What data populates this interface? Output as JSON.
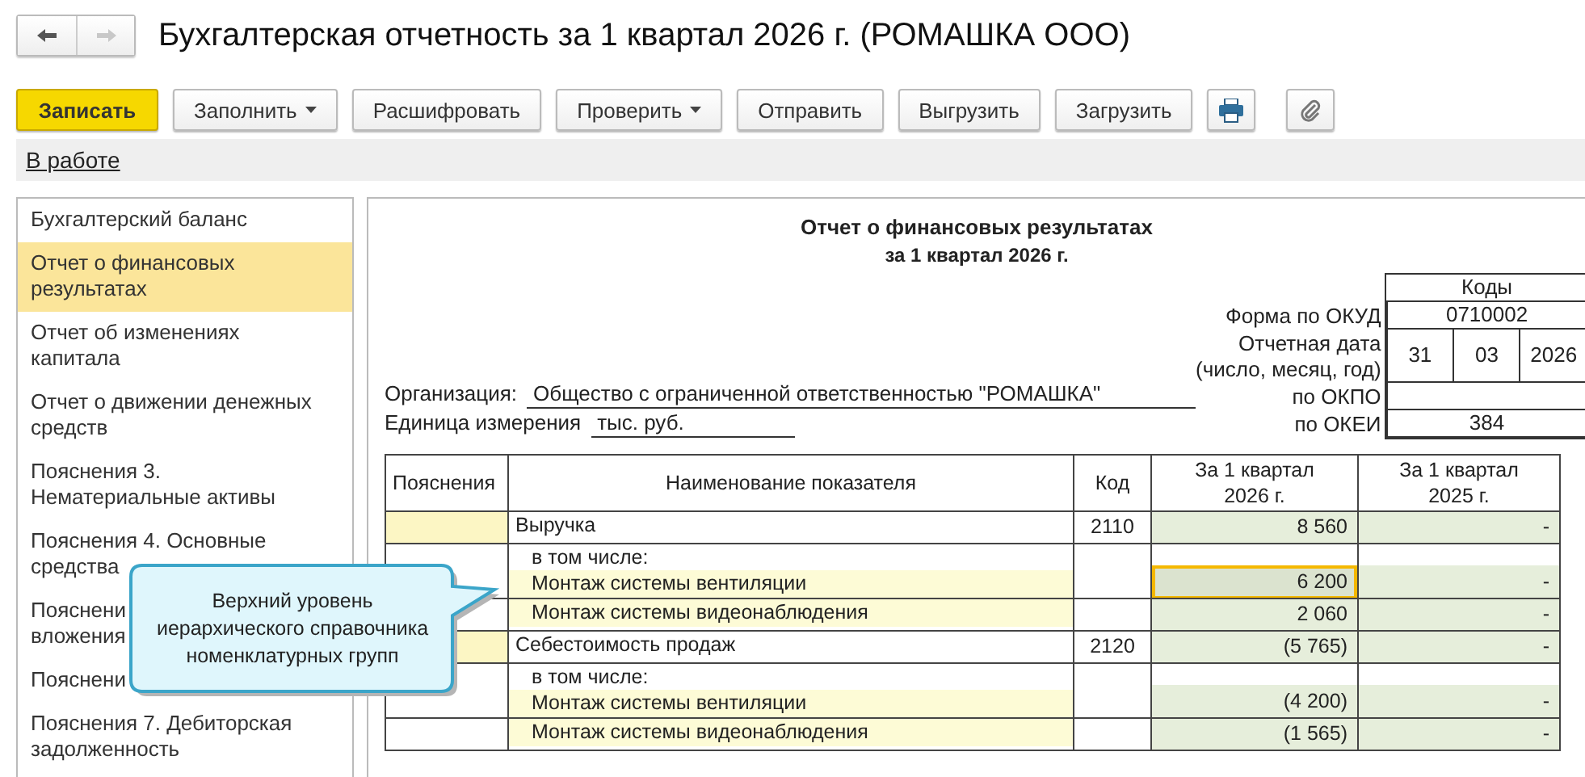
{
  "window": {
    "title": "Бухгалтерская отчетность за 1 квартал 2026 г. (РОМАШКА ООО)",
    "nav": [
      {
        "kind": "back",
        "disabled": false
      },
      {
        "kind": "forward",
        "disabled": true
      }
    ]
  },
  "toolbar": [
    {
      "kind": "primary",
      "label": "Записать"
    },
    {
      "kind": "menu",
      "label": "Заполнить"
    },
    {
      "kind": "plain",
      "label": "Расшифровать"
    },
    {
      "kind": "menu",
      "label": "Проверить"
    },
    {
      "kind": "plain",
      "label": "Отправить"
    },
    {
      "kind": "plain",
      "label": "Выгрузить"
    },
    {
      "kind": "plain",
      "label": "Загрузить"
    },
    {
      "kind": "print"
    },
    {
      "kind": "attach"
    }
  ],
  "status_link": "В работе",
  "sidebar": {
    "items": [
      {
        "lines": [
          "Бухгалтерский баланс"
        ],
        "selected": false
      },
      {
        "lines": [
          "Отчет о финансовых",
          "результатах"
        ],
        "selected": true
      },
      {
        "lines": [
          "Отчет об изменениях",
          "капитала"
        ],
        "selected": false
      },
      {
        "lines": [
          "Отчет о движении денежных",
          "средств"
        ],
        "selected": false
      },
      {
        "lines": [
          "Пояснения 3.",
          "Нематериальные активы"
        ],
        "selected": false
      },
      {
        "lines": [
          "Пояснения 4. Основные",
          "средства"
        ],
        "selected": false
      },
      {
        "lines": [
          "Пояснени",
          "вложения"
        ],
        "selected": false
      },
      {
        "lines": [
          "Пояснени"
        ],
        "selected": false
      },
      {
        "lines": [
          "Пояснения 7. Дебиторская",
          "задолженность"
        ],
        "selected": false
      }
    ]
  },
  "report": {
    "title": "Отчет о финансовых результатах",
    "subtitle": "за 1 квартал 2026 г.",
    "codes_header": "Коды",
    "okud_label": "Форма по ОКУД",
    "okud": "0710002",
    "date_label": [
      "Отчетная дата",
      "(число, месяц, год)"
    ],
    "date": [
      "31",
      "03",
      "2026"
    ],
    "org_label": "Организация:",
    "org": "Общество с ограниченной ответственностью \"РОМАШКА\"",
    "okpo_label": "по ОКПО",
    "unit_label": "Единица измерения",
    "unit": "тыс. руб.",
    "okei_label": "по ОКЕИ",
    "okei": "384",
    "table": {
      "columns": [
        "Пояснения",
        "Наименование показателя",
        "Код",
        [
          "За 1 квартал",
          "2026 г."
        ],
        [
          "За 1 квартал",
          "2025 г."
        ]
      ],
      "rows": [
        {
          "caption": "",
          "name": "Выручка",
          "indent": false,
          "code": "2110",
          "current": "8 560",
          "previous": "-",
          "selected": false
        },
        {
          "caption": "в том числе:",
          "name": "Монтаж системы вентиляции",
          "indent": true,
          "code": "",
          "current": "6 200",
          "previous": "-",
          "selected": true
        },
        {
          "caption": "",
          "name": "Монтаж системы видеонаблюдения",
          "indent": true,
          "code": "",
          "current": "2 060",
          "previous": "-",
          "selected": false
        },
        {
          "caption": "",
          "name": "Себестоимость продаж",
          "indent": false,
          "code": "2120",
          "current": "(5 765)",
          "previous": "-",
          "selected": false
        },
        {
          "caption": "в том числе:",
          "name": "Монтаж системы вентиляции",
          "indent": true,
          "code": "",
          "current": "(4 200)",
          "previous": "-",
          "selected": false
        },
        {
          "caption": "",
          "name": "Монтаж системы видеонаблюдения",
          "indent": true,
          "code": "",
          "current": "(1 565)",
          "previous": "-",
          "selected": false
        }
      ]
    }
  },
  "callout": [
    "Верхний уровень",
    "иерархического справочника",
    "номенклатурных групп"
  ]
}
